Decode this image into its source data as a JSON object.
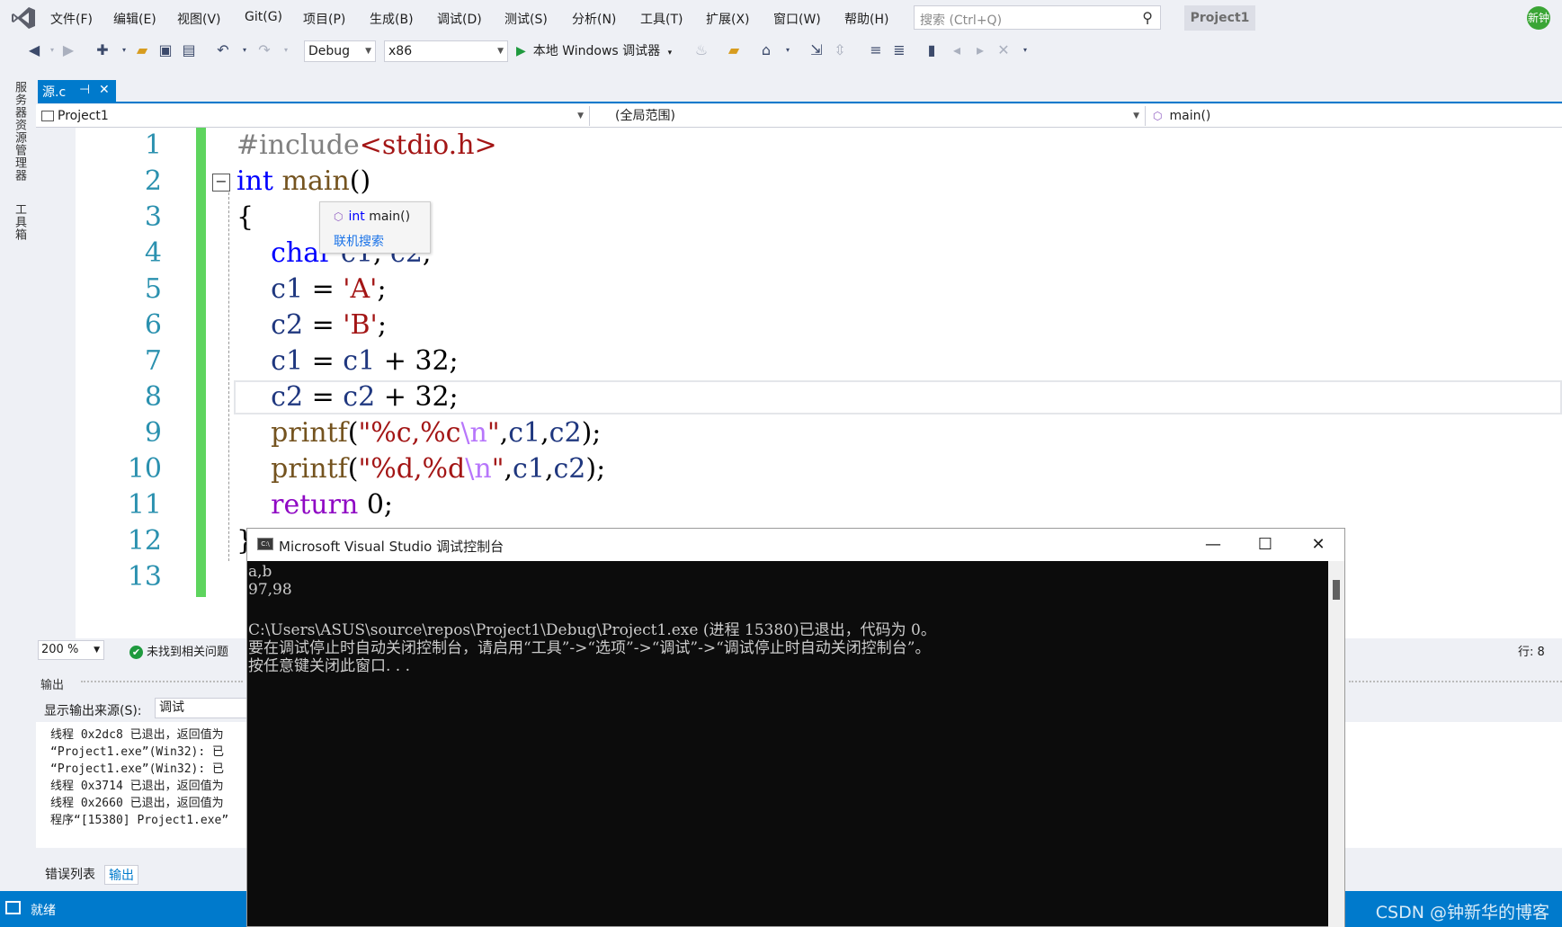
{
  "menubar": {
    "items": [
      "文件(F)",
      "编辑(E)",
      "视图(V)",
      "Git(G)",
      "项目(P)",
      "生成(B)",
      "调试(D)",
      "测试(S)",
      "分析(N)",
      "工具(T)",
      "扩展(X)",
      "窗口(W)",
      "帮助(H)"
    ],
    "search_placeholder": "搜索 (Ctrl+Q)",
    "project_title": "Project1",
    "avatar_text": "新钟"
  },
  "toolbar": {
    "config": "Debug",
    "platform": "x86",
    "run_label": "本地 Windows 调试器"
  },
  "left_strip": {
    "tabs": [
      "服务器资源管理器",
      "工具箱"
    ]
  },
  "document_tab": {
    "label": "源.c",
    "pin": "⊣",
    "close": "✕"
  },
  "navbar": {
    "project": "Project1",
    "scope": "(全局范围)",
    "member": "main()"
  },
  "editor": {
    "line_numbers": [
      "1",
      "2",
      "3",
      "4",
      "5",
      "6",
      "7",
      "8",
      "9",
      "10",
      "11",
      "12",
      "13"
    ],
    "lines": [
      [
        {
          "t": "#include",
          "c": "pp"
        },
        {
          "t": "<stdio.h>",
          "c": "str"
        }
      ],
      [
        {
          "t": "int",
          "c": "kw"
        },
        {
          "t": " ",
          "c": ""
        },
        {
          "t": "main",
          "c": "fn"
        },
        {
          "t": "()",
          "c": ""
        }
      ],
      [
        {
          "t": "{",
          "c": ""
        }
      ],
      [
        {
          "t": "    char",
          "c": "kw"
        },
        {
          "t": " ",
          "c": ""
        },
        {
          "t": "c1",
          "c": "var"
        },
        {
          "t": ", ",
          "c": ""
        },
        {
          "t": "c2",
          "c": "var"
        },
        {
          "t": ";",
          "c": ""
        }
      ],
      [
        {
          "t": "    c1",
          "c": "var"
        },
        {
          "t": " = ",
          "c": ""
        },
        {
          "t": "'A'",
          "c": "str"
        },
        {
          "t": ";",
          "c": ""
        }
      ],
      [
        {
          "t": "    c2",
          "c": "var"
        },
        {
          "t": " = ",
          "c": ""
        },
        {
          "t": "'B'",
          "c": "str"
        },
        {
          "t": ";",
          "c": ""
        }
      ],
      [
        {
          "t": "    c1",
          "c": "var"
        },
        {
          "t": " = ",
          "c": ""
        },
        {
          "t": "c1",
          "c": "var"
        },
        {
          "t": " + 32;",
          "c": ""
        }
      ],
      [
        {
          "t": "    c2",
          "c": "var"
        },
        {
          "t": " = ",
          "c": ""
        },
        {
          "t": "c2",
          "c": "var"
        },
        {
          "t": " + 32;",
          "c": ""
        }
      ],
      [
        {
          "t": "    printf",
          "c": "fn"
        },
        {
          "t": "(",
          "c": ""
        },
        {
          "t": "\"%c,%c",
          "c": "str"
        },
        {
          "t": "\\n",
          "c": "esc"
        },
        {
          "t": "\"",
          "c": "str"
        },
        {
          "t": ",",
          "c": ""
        },
        {
          "t": "c1",
          "c": "var"
        },
        {
          "t": ",",
          "c": ""
        },
        {
          "t": "c2",
          "c": "var"
        },
        {
          "t": ");",
          "c": ""
        }
      ],
      [
        {
          "t": "    printf",
          "c": "fn"
        },
        {
          "t": "(",
          "c": ""
        },
        {
          "t": "\"%d,%d",
          "c": "str"
        },
        {
          "t": "\\n",
          "c": "esc"
        },
        {
          "t": "\"",
          "c": "str"
        },
        {
          "t": ",",
          "c": ""
        },
        {
          "t": "c1",
          "c": "var"
        },
        {
          "t": ",",
          "c": ""
        },
        {
          "t": "c2",
          "c": "var"
        },
        {
          "t": ");",
          "c": ""
        }
      ],
      [
        {
          "t": "    return",
          "c": "ret"
        },
        {
          "t": " 0;",
          "c": ""
        }
      ],
      [
        {
          "t": "}",
          "c": ""
        }
      ],
      []
    ]
  },
  "tooltip": {
    "keyword": "int",
    "function": "main()",
    "online_search": "联机搜索"
  },
  "editor_status": {
    "zoom": "200 %",
    "issues": "未找到相关问题",
    "line_indicator": "行: 8"
  },
  "output": {
    "header": "输出",
    "source_label": "显示输出来源(S):",
    "source_value": "调试",
    "lines": [
      "线程 0x2dc8 已退出，返回值为",
      "“Project1.exe”(Win32): 已",
      "“Project1.exe”(Win32): 已",
      "线程 0x3714 已退出，返回值为",
      "线程 0x2660 已退出，返回值为",
      "程序“[15380] Project1.exe”"
    ]
  },
  "bottom_tabs": [
    "错误列表",
    "输出"
  ],
  "statusbar": {
    "ready": "就绪",
    "watermark": "CSDN @钟新华的博客"
  },
  "console": {
    "title": "Microsoft Visual Studio 调试控制台",
    "icon_text": "C:\\",
    "lines": [
      "a,b",
      "97,98",
      "",
      "C:\\Users\\ASUS\\source\\repos\\Project1\\Debug\\Project1.exe (进程 15380)已退出，代码为 0。",
      "要在调试停止时自动关闭控制台，请启用“工具”->“选项”->“调试”->“调试停止时自动关闭控制台”。",
      "按任意键关闭此窗口. . ."
    ]
  },
  "colors": {
    "accent": "#007acc",
    "change_bar": "#5ed45e",
    "line_number": "#2b91af",
    "keyword": "#0000ff",
    "string": "#a31515"
  }
}
